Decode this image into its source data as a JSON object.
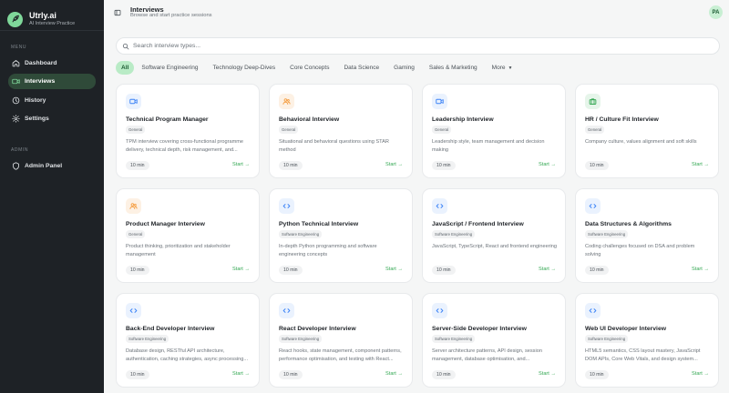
{
  "brand": {
    "name": "Utrly.ai",
    "subtitle": "AI Interview Practice"
  },
  "sidebar": {
    "menu_label": "MENU",
    "admin_label": "ADMIN",
    "items": [
      {
        "label": "Dashboard",
        "icon": "dashboard-icon",
        "active": false
      },
      {
        "label": "Interviews",
        "icon": "video-icon",
        "active": true
      },
      {
        "label": "History",
        "icon": "history-icon",
        "active": false
      },
      {
        "label": "Settings",
        "icon": "gear-icon",
        "active": false
      }
    ],
    "admin_items": [
      {
        "label": "Admin Panel",
        "icon": "shield-icon",
        "active": false
      }
    ]
  },
  "header": {
    "title": "Interviews",
    "subtitle": "Browse and start practice sessions",
    "avatar": "PA"
  },
  "search": {
    "placeholder": "Search interview types..."
  },
  "filters": {
    "chips": [
      "All",
      "Software Engineering",
      "Technology Deep-Dives",
      "Core Concepts",
      "Data Science",
      "Gaming",
      "Sales & Marketing"
    ],
    "active_index": 0,
    "more_label": "More"
  },
  "colors": {
    "accent": "#34a853",
    "chip_active_bg": "#b9ebc6",
    "sidebar_bg": "#1e2226",
    "sidebar_active_bg": "#2f4a39",
    "icon_blue": "#3b82f6",
    "icon_orange": "#f59e42",
    "icon_green": "#34a853"
  },
  "cards": [
    {
      "title": "Technical Program Manager",
      "tag": "General",
      "desc": "TPM interview covering cross-functional programme delivery, technical depth, risk management, and...",
      "duration": "10 min",
      "start": "Start →",
      "icon": "video-icon",
      "icon_color": "blue"
    },
    {
      "title": "Behavioral Interview",
      "tag": "General",
      "desc": "Situational and behavioral questions using STAR method",
      "duration": "10 min",
      "start": "Start →",
      "icon": "users-icon",
      "icon_color": "orange"
    },
    {
      "title": "Leadership Interview",
      "tag": "General",
      "desc": "Leadership style, team management and decision making",
      "duration": "10 min",
      "start": "Start →",
      "icon": "video-icon",
      "icon_color": "blue"
    },
    {
      "title": "HR / Culture Fit Interview",
      "tag": "General",
      "desc": "Company culture, values alignment and soft skills",
      "duration": "10 min",
      "start": "Start →",
      "icon": "briefcase-icon",
      "icon_color": "green"
    },
    {
      "title": "Product Manager Interview",
      "tag": "General",
      "desc": "Product thinking, prioritization and stakeholder management",
      "duration": "10 min",
      "start": "Start →",
      "icon": "users-icon",
      "icon_color": "orange"
    },
    {
      "title": "Python Technical Interview",
      "tag": "Software Engineering",
      "desc": "In-depth Python programming and software engineering concepts",
      "duration": "10 min",
      "start": "Start →",
      "icon": "code-icon",
      "icon_color": "blue"
    },
    {
      "title": "JavaScript / Frontend Interview",
      "tag": "Software Engineering",
      "desc": "JavaScript, TypeScript, React and frontend engineering",
      "duration": "10 min",
      "start": "Start →",
      "icon": "code-icon",
      "icon_color": "blue"
    },
    {
      "title": "Data Structures & Algorithms",
      "tag": "Software Engineering",
      "desc": "Coding challenges focused on DSA and problem solving",
      "duration": "10 min",
      "start": "Start →",
      "icon": "code-icon",
      "icon_color": "blue"
    },
    {
      "title": "Back-End Developer Interview",
      "tag": "Software Engineering",
      "desc": "Database design, RESTful API architecture, authentication, caching strategies, async processing...",
      "duration": "10 min",
      "start": "Start →",
      "icon": "code-icon",
      "icon_color": "blue"
    },
    {
      "title": "React Developer Interview",
      "tag": "Software Engineering",
      "desc": "React hooks, state management, component patterns, performance optimisation, and testing with React...",
      "duration": "10 min",
      "start": "Start →",
      "icon": "code-icon",
      "icon_color": "blue"
    },
    {
      "title": "Server-Side Developer Interview",
      "tag": "Software Engineering",
      "desc": "Server architecture patterns, API design, session management, database optimisation, and...",
      "duration": "10 min",
      "start": "Start →",
      "icon": "code-icon",
      "icon_color": "blue"
    },
    {
      "title": "Web UI Developer Interview",
      "tag": "Software Engineering",
      "desc": "HTML5 semantics, CSS layout mastery, JavaScript DOM APIs, Core Web Vitals, and design system...",
      "duration": "10 min",
      "start": "Start →",
      "icon": "code-icon",
      "icon_color": "blue"
    }
  ]
}
